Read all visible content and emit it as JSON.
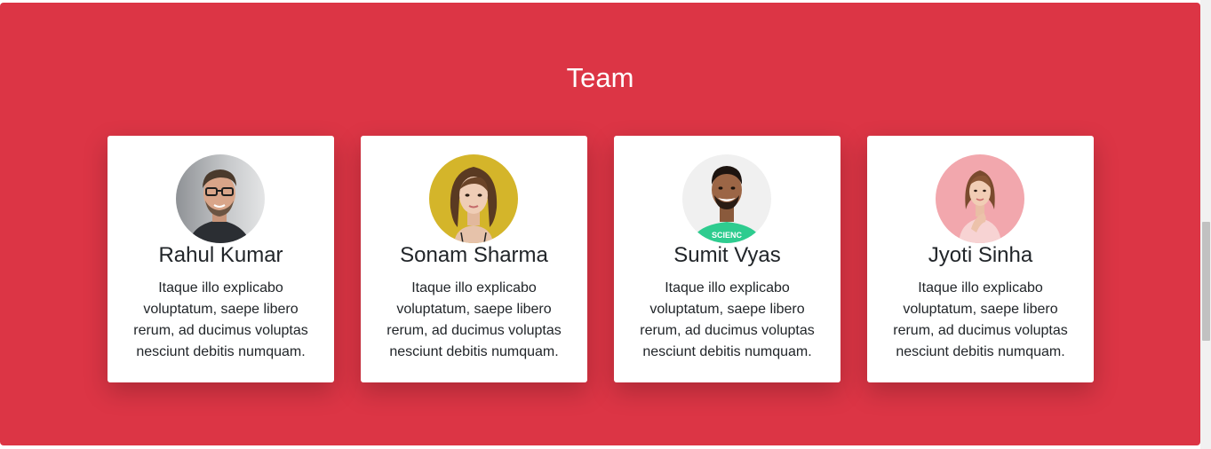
{
  "section": {
    "title": "Team",
    "background_color": "#dc3545"
  },
  "members": [
    {
      "name": "Rahul Kumar",
      "bio": "Itaque illo explicabo voluptatum, saepe libero rerum, ad ducimus voluptas nesciunt debitis numquam.",
      "avatar": "man-with-glasses-photo"
    },
    {
      "name": "Sonam Sharma",
      "bio": "Itaque illo explicabo voluptatum, saepe libero rerum, ad ducimus voluptas nesciunt debitis numquam.",
      "avatar": "woman-yellow-background-photo"
    },
    {
      "name": "Sumit Vyas",
      "bio": "Itaque illo explicabo voluptatum, saepe libero rerum, ad ducimus voluptas nesciunt debitis numquam.",
      "avatar": "man-green-shirt-photo"
    },
    {
      "name": "Jyoti Sinha",
      "bio": "Itaque illo explicabo voluptatum, saepe libero rerum, ad ducimus voluptas nesciunt debitis numquam.",
      "avatar": "woman-pink-background-photo"
    }
  ]
}
